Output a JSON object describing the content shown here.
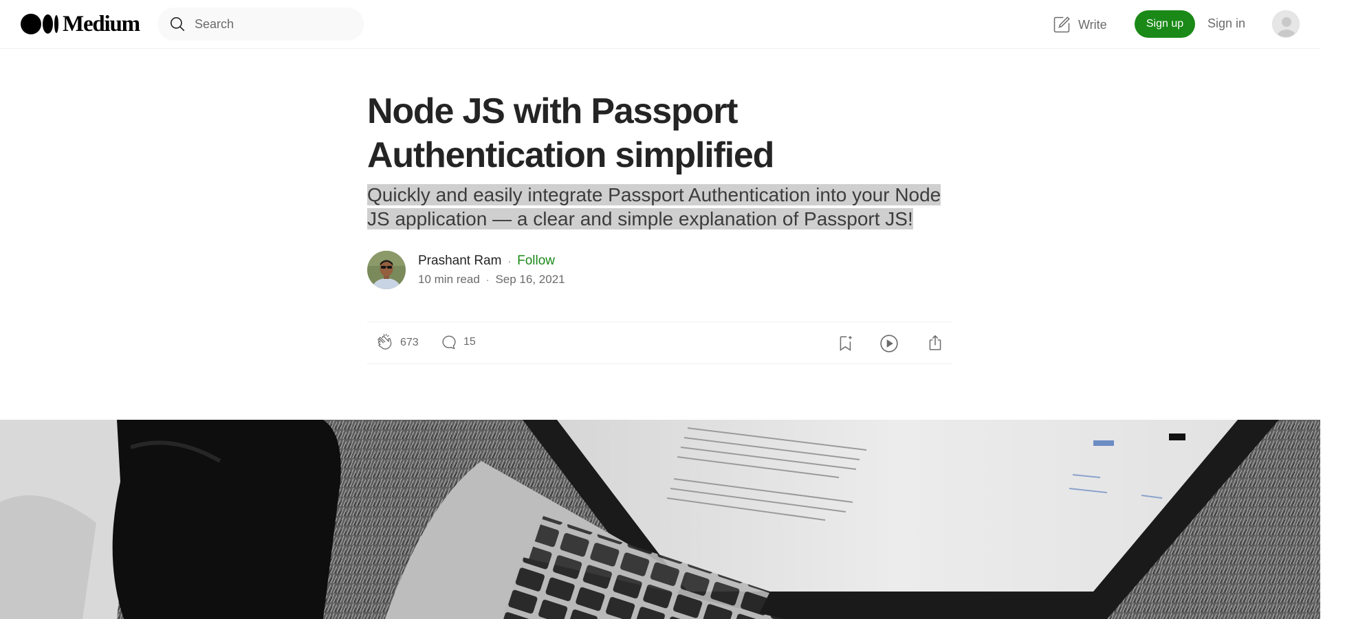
{
  "brand": {
    "name": "Medium"
  },
  "nav": {
    "search_placeholder": "Search",
    "write_label": "Write",
    "signup_label": "Sign up",
    "signin_label": "Sign in"
  },
  "article": {
    "title": "Node JS with Passport Authentication simplified",
    "subtitle": "Quickly and easily integrate Passport Authentication into your Node JS application — a clear and simple explanation of Passport JS!",
    "author": "Prashant Ram",
    "follow_label": "Follow",
    "read_time": "10 min read",
    "date": "Sep 16, 2021",
    "claps": "673",
    "responses": "15"
  },
  "icons": {
    "search": "search-icon",
    "write": "write-icon",
    "clap": "clap-icon",
    "response": "response-icon",
    "bookmark": "bookmark-icon",
    "listen": "play-icon",
    "share": "share-icon"
  },
  "colors": {
    "brand_green": "#1a8917",
    "text": "#242424",
    "muted": "#6b6b6b",
    "highlight": "#cfcfcf"
  }
}
